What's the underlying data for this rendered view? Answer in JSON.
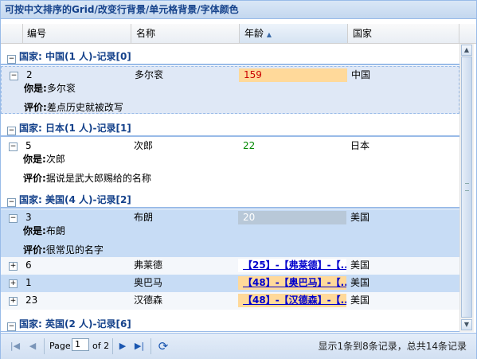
{
  "panel": {
    "title": "可按中文排序的Grid/改变行背景/单元格背景/字体颜色"
  },
  "columns": [
    {
      "label": "编号"
    },
    {
      "label": "名称"
    },
    {
      "label": "年龄",
      "sort": "asc"
    },
    {
      "label": "国家"
    }
  ],
  "groups": [
    {
      "label": "国家: 中国(1 人)-记录[0]"
    },
    {
      "label": "国家: 日本(1 人)-记录[1]"
    },
    {
      "label": "国家: 美国(4 人)-记录[2]"
    },
    {
      "label": "国家: 英国(2 人)-记录[6]"
    }
  ],
  "rows": [
    {
      "id": "2",
      "name": "多尔衮",
      "age": "159",
      "country": "中国",
      "detail_name_label": "你是:",
      "detail_name": "多尔衮",
      "detail_comment_label": "评价:",
      "detail_comment": "差点历史就被改写"
    },
    {
      "id": "5",
      "name": "次郎",
      "age": "22",
      "country": "日本",
      "detail_name_label": "你是:",
      "detail_name": "次郎",
      "detail_comment_label": "评价:",
      "detail_comment": "据说是武大郎赐给的名称"
    },
    {
      "id": "3",
      "name": "布朗",
      "age": "20",
      "country": "美国",
      "detail_name_label": "你是:",
      "detail_name": "布朗",
      "detail_comment_label": "评价:",
      "detail_comment": "很常见的名字"
    },
    {
      "id": "6",
      "name": "弗莱德",
      "age": "【25】-【弗莱德】-【...",
      "country": "美国"
    },
    {
      "id": "1",
      "name": "奥巴马",
      "age": "【48】-【奥巴马】-【...",
      "country": "美国"
    },
    {
      "id": "23",
      "name": "汉德森",
      "age": "【48】-【汉德森】-【...",
      "country": "美国"
    }
  ],
  "colors": {
    "header_text": "#15428b",
    "age_bg_orange": "#ffd99a",
    "age_bg_gray": "#b8c8d8",
    "row_highlight": "#c7dcf5"
  },
  "paging": {
    "page_label": "Page",
    "page_value": "1",
    "of_label": "of 2",
    "status": "显示1条到8条记录，总共14条记录"
  },
  "icons": {
    "first": "first-page-icon",
    "prev": "prev-page-icon",
    "next": "next-page-icon",
    "last": "last-page-icon",
    "refresh": "refresh-icon"
  }
}
